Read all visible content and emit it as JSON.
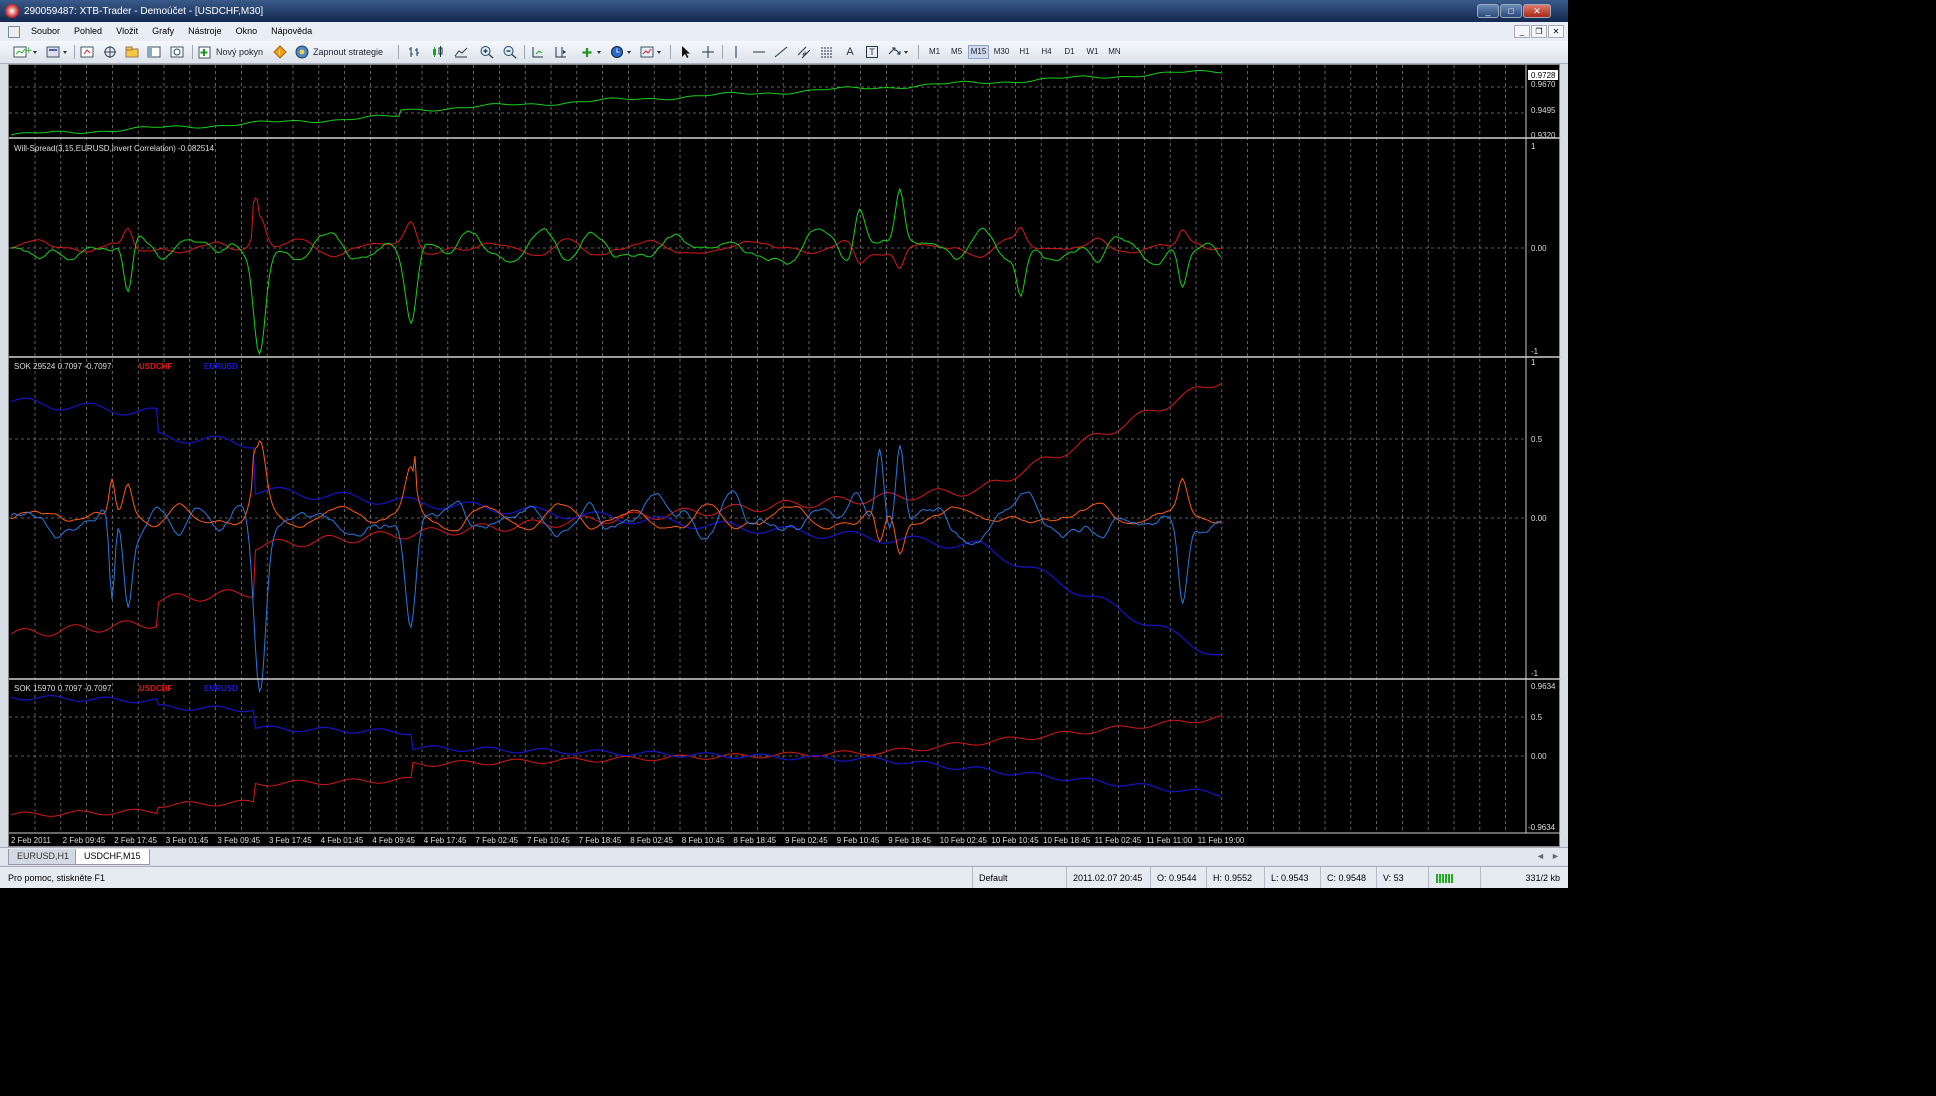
{
  "window": {
    "title": "290059487: XTB-Trader - Demoúčet - [USDCHF,M30]",
    "controls": [
      "_",
      "□",
      "✕"
    ]
  },
  "menu": {
    "items": [
      "Soubor",
      "Pohled",
      "Vložit",
      "Grafy",
      "Nástroje",
      "Okno",
      "Nápověda"
    ],
    "doc_controls": [
      "_",
      "❐",
      "✕"
    ]
  },
  "toolbar": {
    "new_order_label": "Nový pokyn",
    "strategy_label": "Zapnout strategie",
    "timeframes": [
      "M1",
      "M5",
      "M15",
      "M30",
      "H1",
      "H4",
      "D1",
      "W1",
      "MN"
    ],
    "active_timeframe": "M15",
    "tool_letters": {
      "text": "A",
      "label": "T"
    }
  },
  "chart": {
    "price_pane": {
      "scale": [
        "0.9728",
        "0.9670",
        "0.9495",
        "0.9320"
      ],
      "current_price": "0.9728",
      "line_color": "#20c020"
    },
    "pane1": {
      "label": "Will-Spread(3,15,EURUSD,Invert Correlation) -0.082514",
      "scale": [
        "1",
        "0.00",
        "-1"
      ]
    },
    "pane2": {
      "label": "SOK 29524 0.7097 -0.7097",
      "legend": [
        "USDCHF",
        "EURUSD"
      ],
      "scale": [
        "1",
        "0.5",
        "0.00",
        "-1"
      ]
    },
    "pane3": {
      "label": "SOK 15970 0.7097 -0.7097",
      "legend": [
        "USDCHF",
        "EURUSD"
      ],
      "scale": [
        "0.9634",
        "0.5",
        "0.00",
        "-0.9634"
      ]
    },
    "time_axis": [
      "2 Feb 2011",
      "2 Feb 09:45",
      "2 Feb 17:45",
      "3 Feb 01:45",
      "3 Feb 09:45",
      "3 Feb 17:45",
      "4 Feb 01:45",
      "4 Feb 09:45",
      "4 Feb 17:45",
      "7 Feb 02:45",
      "7 Feb 10:45",
      "7 Feb 18:45",
      "8 Feb 02:45",
      "8 Feb 10:45",
      "8 Feb 18:45",
      "9 Feb 02:45",
      "9 Feb 10:45",
      "9 Feb 18:45",
      "10 Feb 02:45",
      "10 Feb 10:45",
      "10 Feb 18:45",
      "11 Feb 02:45",
      "11 Feb 11:00",
      "11 Feb 19:00"
    ],
    "colors": {
      "red": "#d81818",
      "blue": "#1414c8",
      "orange": "#ff5a10",
      "lightblue": "#2a78e0",
      "green": "#18d018",
      "grid": "#7a7a7a"
    }
  },
  "tabs": [
    "EURUSD,H1",
    "USDCHF,M15"
  ],
  "active_tab": "USDCHF,M15",
  "status": {
    "help": "Pro pomoc, stiskněte F1",
    "profile": "Default",
    "datetime": "2011.02.07 20:45",
    "open": "O: 0.9544",
    "high": "H: 0.9552",
    "low": "L: 0.9543",
    "close": "C: 0.9548",
    "volume": "V: 53",
    "traffic": "331/2 kb"
  }
}
